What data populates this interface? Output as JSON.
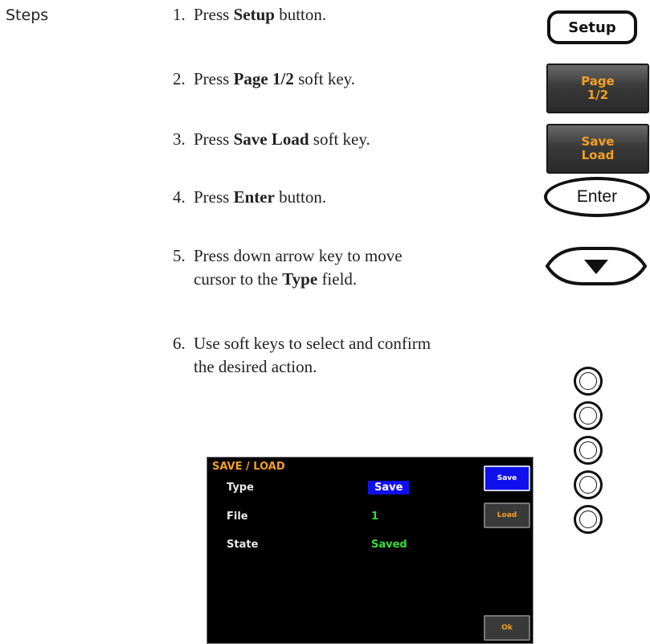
{
  "heading": "Steps",
  "steps": [
    {
      "num": "1.",
      "pre": "Press ",
      "bold": "Setup",
      "post": " button."
    },
    {
      "num": "2.",
      "pre": "Press ",
      "bold": "Page 1/2",
      "post": " soft key."
    },
    {
      "num": "3.",
      "pre": "Press ",
      "bold": "Save Load",
      "post": " soft key."
    },
    {
      "num": "4.",
      "pre": "Press ",
      "bold": "Enter",
      "post": " button."
    },
    {
      "num": "5.",
      "line1": "Press down arrow key to move",
      "line2_pre": "cursor to the ",
      "bold": "Type",
      "line2_post": " field."
    },
    {
      "num": "6.",
      "line1": "Use soft keys to select and confirm",
      "line2": "the desired action."
    }
  ],
  "keys": {
    "setup": "Setup",
    "page_l1": "Page",
    "page_l2": "1/2",
    "save_load_l1": "Save",
    "save_load_l2": "Load",
    "enter": "Enter"
  },
  "screen": {
    "title": "SAVE  /  LOAD",
    "rows": [
      {
        "label": "Type",
        "value": "Save"
      },
      {
        "label": "File",
        "value": "1"
      },
      {
        "label": "State",
        "value": "Saved"
      }
    ],
    "softkeys": {
      "save": "Save",
      "load": "Load",
      "ok": "Ok"
    }
  },
  "colors": {
    "softkey_text": "#f4a020",
    "value_green": "#33dd33",
    "selected_blue": "#1010ee"
  }
}
